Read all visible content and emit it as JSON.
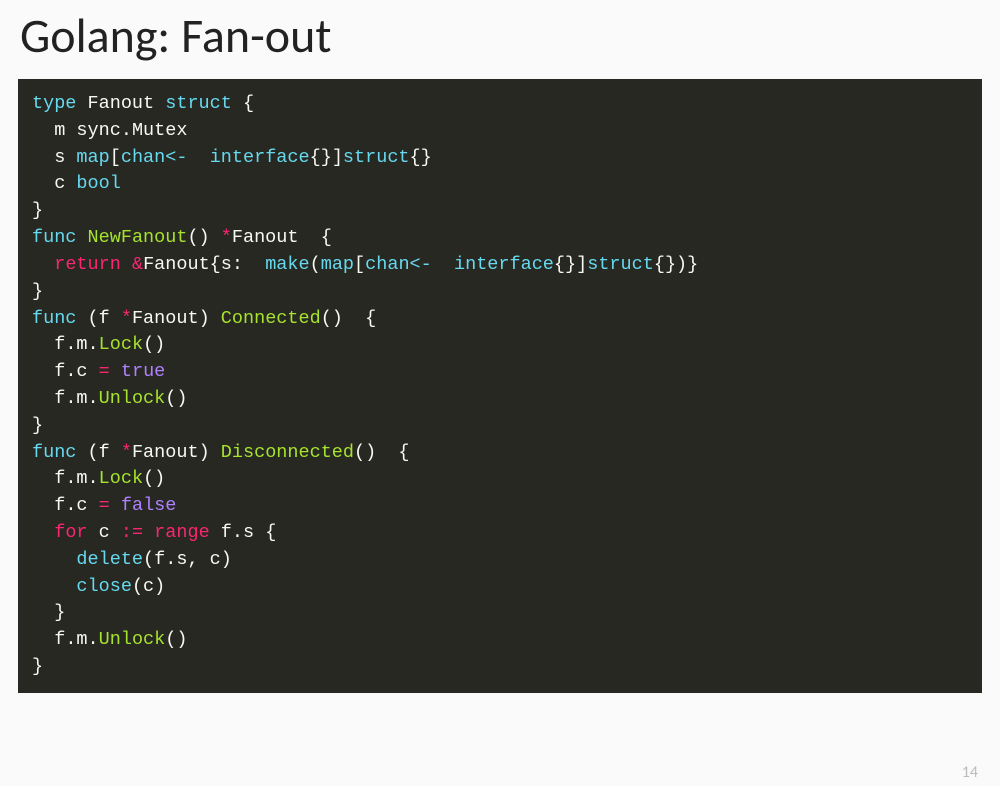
{
  "title": "Golang: Fan-out",
  "page_number": "14",
  "code": {
    "l01": {
      "a": "type",
      "b": " Fanout ",
      "c": "struct",
      "d": " {"
    },
    "l02": {
      "a": "  m sync",
      "b": ".",
      "c": "Mutex"
    },
    "l03": {
      "a": "  s ",
      "b": "map",
      "c": "[",
      "d": "chan<-",
      "e": "  ",
      "f": "interface",
      "g": "{}]",
      "h": "struct",
      "i": "{}"
    },
    "l04": {
      "a": "  c ",
      "b": "bool"
    },
    "l05": {
      "a": "}"
    },
    "l06": {
      "a": ""
    },
    "l07": {
      "a": "func",
      "b": " ",
      "c": "NewFanout",
      "d": "() ",
      "e": "*",
      "f": "Fanout  {"
    },
    "l08": {
      "a": "  ",
      "b": "return",
      "c": " ",
      "d": "&",
      "e": "Fanout{s:  ",
      "f": "make",
      "g": "(",
      "h": "map",
      "i": "[",
      "j": "chan<-",
      "k": "  ",
      "l": "interface",
      "m": "{}]",
      "n": "struct",
      "o": "{})}"
    },
    "l09": {
      "a": "}"
    },
    "l10": {
      "a": ""
    },
    "l11": {
      "a": "func",
      "b": " (f ",
      "c": "*",
      "d": "Fanout) ",
      "e": "Connected",
      "f": "()  {"
    },
    "l12": {
      "a": "  f",
      "b": ".",
      "c": "m",
      "d": ".",
      "e": "Lock",
      "f": "()"
    },
    "l13": {
      "a": "  f",
      "b": ".",
      "c": "c ",
      "d": "=",
      "e": " ",
      "f": "true"
    },
    "l14": {
      "a": "  f",
      "b": ".",
      "c": "m",
      "d": ".",
      "e": "Unlock",
      "f": "()"
    },
    "l15": {
      "a": "}"
    },
    "l16": {
      "a": ""
    },
    "l17": {
      "a": "func",
      "b": " (f ",
      "c": "*",
      "d": "Fanout) ",
      "e": "Disconnected",
      "f": "()  {"
    },
    "l18": {
      "a": "  f",
      "b": ".",
      "c": "m",
      "d": ".",
      "e": "Lock",
      "f": "()"
    },
    "l19": {
      "a": "  f",
      "b": ".",
      "c": "c ",
      "d": "=",
      "e": " ",
      "f": "false"
    },
    "l20": {
      "a": "  ",
      "b": "for",
      "c": " c ",
      "d": ":=",
      "e": " ",
      "f": "range",
      "g": " f",
      "h": ".",
      "i": "s {"
    },
    "l21": {
      "a": "    ",
      "b": "delete",
      "c": "(f",
      "d": ".",
      "e": "s, c)"
    },
    "l22": {
      "a": "    ",
      "b": "close",
      "c": "(c)"
    },
    "l23": {
      "a": "  }"
    },
    "l24": {
      "a": "  f",
      "b": ".",
      "c": "m",
      "d": ".",
      "e": "Unlock",
      "f": "()"
    },
    "l25": {
      "a": "}"
    }
  }
}
